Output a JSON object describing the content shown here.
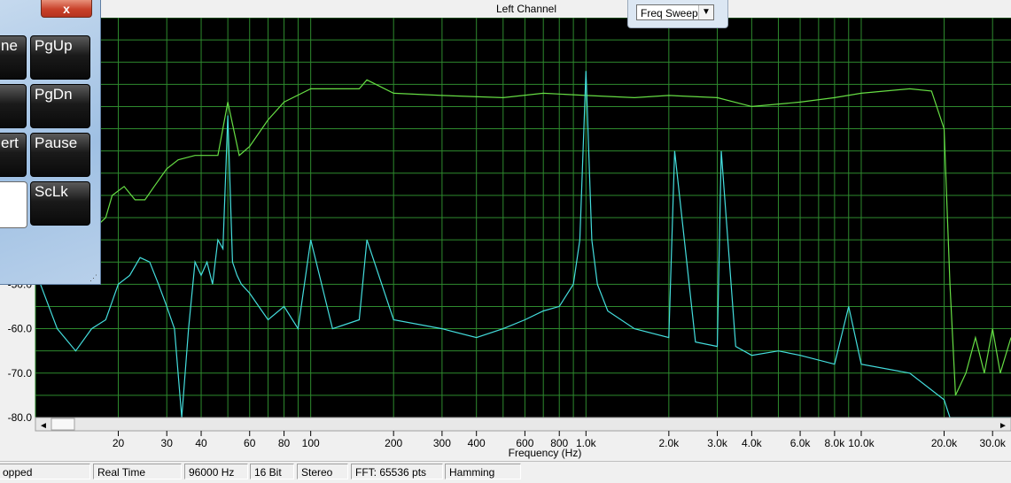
{
  "window": {
    "title": "Left Channel"
  },
  "sweep": {
    "mode": "Freq Sweep"
  },
  "keyboard": {
    "close_label": "x",
    "keys": [
      {
        "label": "ne"
      },
      {
        "label": "PgUp"
      },
      {
        "label": "PgDn"
      },
      {
        "label": "ert"
      },
      {
        "label": "Pause"
      },
      {
        "label": "ScLk"
      }
    ]
  },
  "status": {
    "items": [
      "opped",
      "Real Time",
      "96000 Hz",
      "16 Bit",
      "Stereo",
      "FFT: 65536 pts",
      "Hamming"
    ]
  },
  "colors": {
    "background": "#000000",
    "grid": "#2e8a2e",
    "trace_a": "#66dd44",
    "trace_b": "#44dddd"
  },
  "chart_data": {
    "type": "line",
    "title": "Left Channel",
    "xlabel": "Frequency (Hz)",
    "ylabel": "",
    "x_scale": "log",
    "xlim": [
      10,
      35000
    ],
    "ylim": [
      -80,
      10
    ],
    "grid": true,
    "y_ticks": [
      "-50.0",
      "-60.0",
      "-70.0",
      "-80.0"
    ],
    "y_tick_values": [
      -50,
      -60,
      -70,
      -80
    ],
    "x_ticks": [
      "20",
      "30",
      "40",
      "60",
      "80",
      "100",
      "200",
      "300",
      "400",
      "600",
      "800",
      "1.0k",
      "2.0k",
      "3.0k",
      "4.0k",
      "6.0k",
      "8.0k",
      "10.0k",
      "20.0k",
      "30.0k"
    ],
    "x_tick_values": [
      20,
      30,
      40,
      60,
      80,
      100,
      200,
      300,
      400,
      600,
      800,
      1000,
      2000,
      3000,
      4000,
      6000,
      8000,
      10000,
      20000,
      30000
    ],
    "series": [
      {
        "color": "#66dd44",
        "x": [
          10,
          13,
          16,
          18,
          19,
          21,
          23,
          25,
          27,
          30,
          33,
          38,
          42,
          46,
          50,
          55,
          60,
          70,
          80,
          100,
          150,
          160,
          200,
          300,
          500,
          700,
          1000,
          1500,
          2000,
          3000,
          4000,
          6000,
          8000,
          10000,
          15000,
          18000,
          20000,
          21000,
          22000,
          24000,
          26000,
          28000,
          30000,
          32000,
          35000
        ],
        "y": [
          -40,
          -40,
          -38,
          -35,
          -30,
          -28,
          -31,
          -31,
          -28,
          -24,
          -22,
          -21,
          -21,
          -21,
          -9,
          -21,
          -19,
          -13,
          -9,
          -6,
          -6,
          -4,
          -7,
          -7.5,
          -8,
          -7,
          -7.5,
          -8,
          -7.5,
          -8,
          -10,
          -9,
          -8,
          -7,
          -6,
          -6.5,
          -15,
          -50,
          -75,
          -70,
          -62,
          -70,
          -60,
          -70,
          -62
        ]
      },
      {
        "color": "#44dddd",
        "x": [
          10,
          12,
          14,
          16,
          18,
          20,
          22,
          24,
          26,
          28,
          30,
          32,
          34,
          36,
          38,
          40,
          42,
          44,
          46,
          48,
          50,
          52,
          54,
          56,
          60,
          70,
          80,
          90,
          100,
          120,
          150,
          160,
          200,
          300,
          400,
          500,
          600,
          700,
          800,
          900,
          950,
          1000,
          1050,
          1100,
          1200,
          1500,
          2000,
          2100,
          2500,
          3000,
          3100,
          3500,
          4000,
          5000,
          6000,
          8000,
          9000,
          10000,
          15000,
          20000,
          21000,
          25000,
          30000,
          35000
        ],
        "y": [
          -47,
          -60,
          -65,
          -60,
          -58,
          -50,
          -48,
          -44,
          -45,
          -50,
          -55,
          -60,
          -80,
          -60,
          -45,
          -48,
          -45,
          -50,
          -40,
          -42,
          -12,
          -45,
          -48,
          -50,
          -52,
          -58,
          -55,
          -60,
          -40,
          -60,
          -58,
          -40,
          -58,
          -60,
          -62,
          -60,
          -58,
          -56,
          -55,
          -50,
          -40,
          -2,
          -40,
          -50,
          -56,
          -60,
          -62,
          -20,
          -63,
          -64,
          -20,
          -64,
          -66,
          -65,
          -66,
          -68,
          -55,
          -68,
          -70,
          -76,
          -80,
          -80,
          -80,
          -80
        ]
      }
    ]
  }
}
